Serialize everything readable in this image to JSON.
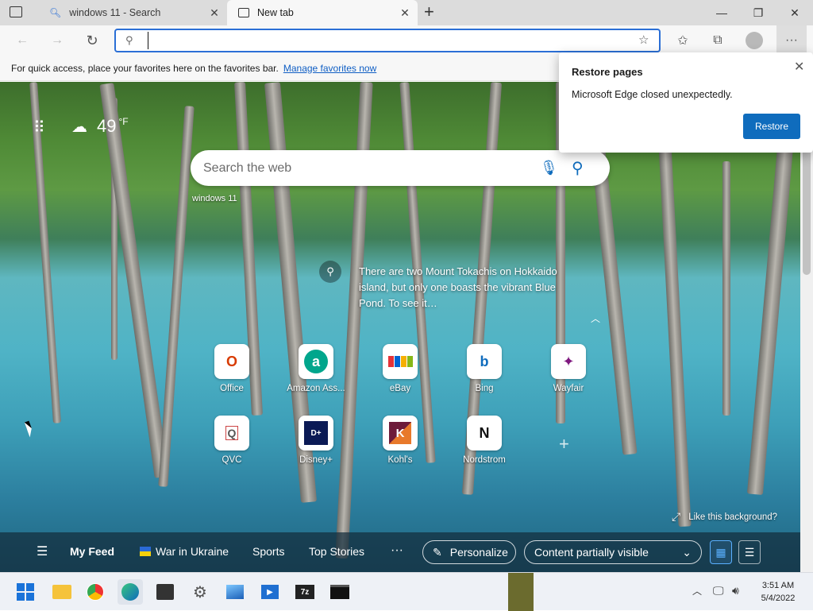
{
  "tabs": [
    {
      "label": "windows 11 - Search",
      "icon": "search-icon"
    },
    {
      "label": "New tab",
      "icon": "newtab-icon"
    }
  ],
  "address": {
    "value": "",
    "placeholder": ""
  },
  "favorites_bar": {
    "message": "For quick access, place your favorites here on the favorites bar.",
    "link": "Manage favorites now"
  },
  "restore": {
    "title": "Restore pages",
    "message": "Microsoft Edge closed unexpectedly.",
    "button": "Restore"
  },
  "weather": {
    "temp": "49",
    "unit": "°F"
  },
  "search": {
    "placeholder": "Search the web",
    "recent": "windows 11"
  },
  "caption": "There are two Mount Tokachis on Hokkaido island, but only one boasts the vibrant Blue Pond. To see it…",
  "tiles": [
    {
      "name": "Office",
      "glyph": "O",
      "color": "#d83b01"
    },
    {
      "name": "Amazon Ass...",
      "glyph": "a",
      "color": "#00a68c"
    },
    {
      "name": "eBay",
      "glyph": "e",
      "color": "#e53238"
    },
    {
      "name": "Bing",
      "glyph": "b",
      "color": "#0f6cbd"
    },
    {
      "name": "Wayfair",
      "glyph": "✦",
      "color": "#7f187f"
    },
    {
      "name": "QVC",
      "glyph": "Q",
      "color": "#5a5a5a"
    },
    {
      "name": "Disney+",
      "glyph": "D+",
      "color": "#0b1a55"
    },
    {
      "name": "Kohl's",
      "glyph": "K",
      "color": "#6d1b3a"
    },
    {
      "name": "Nordstrom",
      "glyph": "N",
      "color": "#111111"
    }
  ],
  "like_background": "Like this background?",
  "feed": {
    "my_feed": "My Feed",
    "items": [
      "War in Ukraine",
      "Sports",
      "Top Stories"
    ],
    "more": "···",
    "personalize": "Personalize",
    "content": "Content partially visible"
  },
  "clock": {
    "time": "3:51 AM",
    "date": "5/4/2022"
  },
  "taskbar_icons": [
    "windows-start-icon",
    "file-explorer-icon",
    "chrome-icon",
    "edge-icon",
    "store-icon",
    "settings-icon",
    "photos-icon",
    "media-player-icon",
    "7zip-icon",
    "terminal-icon"
  ]
}
